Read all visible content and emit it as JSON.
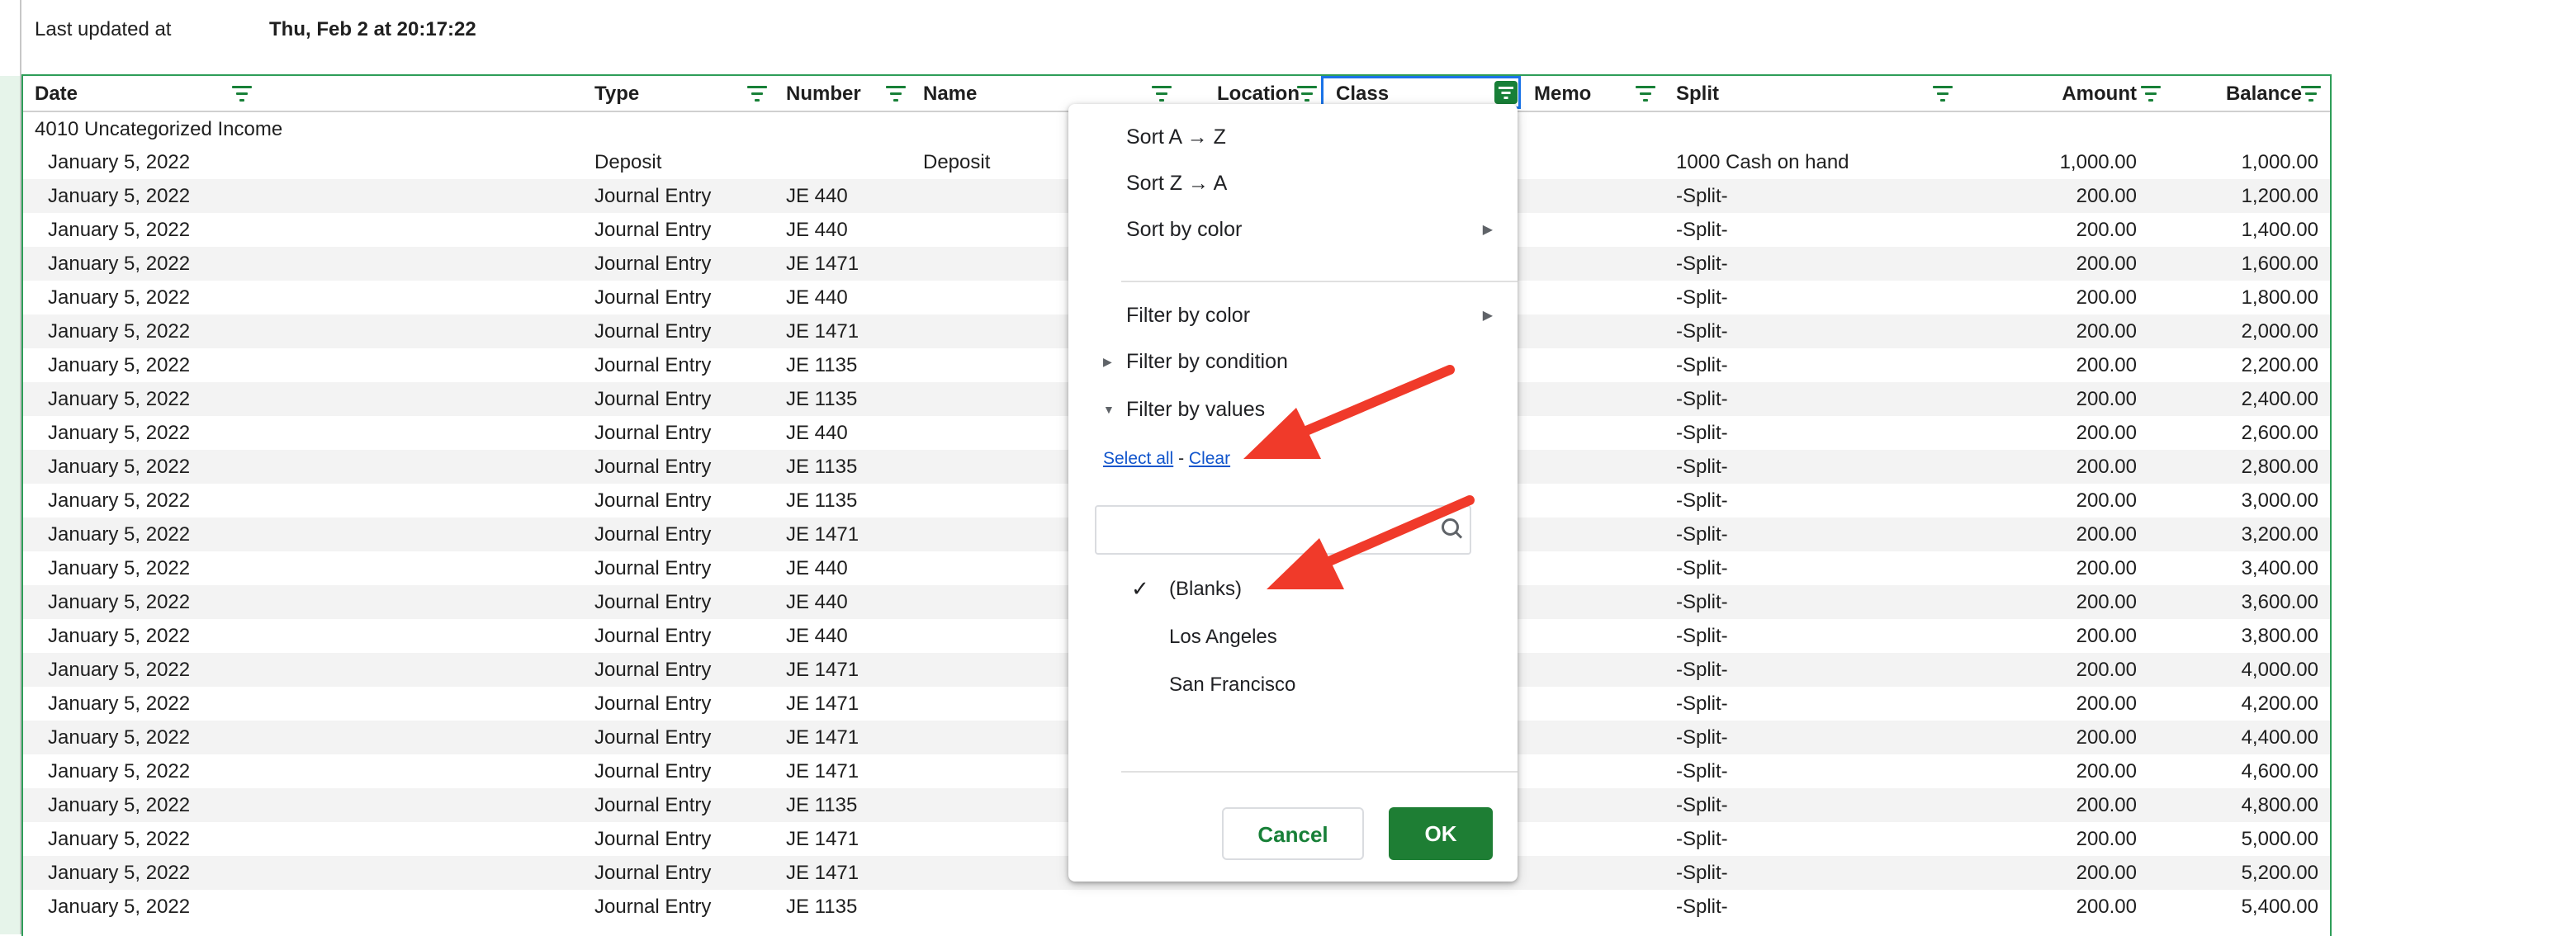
{
  "last_updated": {
    "label": "Last updated at",
    "value": "Thu, Feb 2 at 20:17:22"
  },
  "columns": [
    {
      "key": "date",
      "label": "Date"
    },
    {
      "key": "type",
      "label": "Type"
    },
    {
      "key": "number",
      "label": "Number"
    },
    {
      "key": "name",
      "label": "Name"
    },
    {
      "key": "location",
      "label": "Location"
    },
    {
      "key": "class",
      "label": "Class"
    },
    {
      "key": "memo",
      "label": "Memo"
    },
    {
      "key": "split",
      "label": "Split"
    },
    {
      "key": "amount",
      "label": "Amount"
    },
    {
      "key": "balance",
      "label": "Balance"
    }
  ],
  "group_label": "4010 Uncategorized Income",
  "rows": [
    {
      "date": "January 5, 2022",
      "type": "Deposit",
      "number": "",
      "name": "Deposit",
      "split": "1000 Cash on hand",
      "amount": "1,000.00",
      "balance": "1,000.00"
    },
    {
      "date": "January 5, 2022",
      "type": "Journal Entry",
      "number": "JE 440",
      "name": "",
      "split": "-Split-",
      "amount": "200.00",
      "balance": "1,200.00"
    },
    {
      "date": "January 5, 2022",
      "type": "Journal Entry",
      "number": "JE 440",
      "name": "",
      "split": "-Split-",
      "amount": "200.00",
      "balance": "1,400.00"
    },
    {
      "date": "January 5, 2022",
      "type": "Journal Entry",
      "number": "JE 1471",
      "name": "",
      "split": "-Split-",
      "amount": "200.00",
      "balance": "1,600.00"
    },
    {
      "date": "January 5, 2022",
      "type": "Journal Entry",
      "number": "JE 440",
      "name": "",
      "split": "-Split-",
      "amount": "200.00",
      "balance": "1,800.00"
    },
    {
      "date": "January 5, 2022",
      "type": "Journal Entry",
      "number": "JE 1471",
      "name": "",
      "split": "-Split-",
      "amount": "200.00",
      "balance": "2,000.00"
    },
    {
      "date": "January 5, 2022",
      "type": "Journal Entry",
      "number": "JE 1135",
      "name": "",
      "split": "-Split-",
      "amount": "200.00",
      "balance": "2,200.00"
    },
    {
      "date": "January 5, 2022",
      "type": "Journal Entry",
      "number": "JE 1135",
      "name": "",
      "split": "-Split-",
      "amount": "200.00",
      "balance": "2,400.00"
    },
    {
      "date": "January 5, 2022",
      "type": "Journal Entry",
      "number": "JE 440",
      "name": "",
      "split": "-Split-",
      "amount": "200.00",
      "balance": "2,600.00"
    },
    {
      "date": "January 5, 2022",
      "type": "Journal Entry",
      "number": "JE 1135",
      "name": "",
      "split": "-Split-",
      "amount": "200.00",
      "balance": "2,800.00"
    },
    {
      "date": "January 5, 2022",
      "type": "Journal Entry",
      "number": "JE 1135",
      "name": "",
      "split": "-Split-",
      "amount": "200.00",
      "balance": "3,000.00"
    },
    {
      "date": "January 5, 2022",
      "type": "Journal Entry",
      "number": "JE 1471",
      "name": "",
      "split": "-Split-",
      "amount": "200.00",
      "balance": "3,200.00"
    },
    {
      "date": "January 5, 2022",
      "type": "Journal Entry",
      "number": "JE 440",
      "name": "",
      "split": "-Split-",
      "amount": "200.00",
      "balance": "3,400.00"
    },
    {
      "date": "January 5, 2022",
      "type": "Journal Entry",
      "number": "JE 440",
      "name": "",
      "split": "-Split-",
      "amount": "200.00",
      "balance": "3,600.00"
    },
    {
      "date": "January 5, 2022",
      "type": "Journal Entry",
      "number": "JE 440",
      "name": "",
      "split": "-Split-",
      "amount": "200.00",
      "balance": "3,800.00"
    },
    {
      "date": "January 5, 2022",
      "type": "Journal Entry",
      "number": "JE 1471",
      "name": "",
      "split": "-Split-",
      "amount": "200.00",
      "balance": "4,000.00"
    },
    {
      "date": "January 5, 2022",
      "type": "Journal Entry",
      "number": "JE 1471",
      "name": "",
      "split": "-Split-",
      "amount": "200.00",
      "balance": "4,200.00"
    },
    {
      "date": "January 5, 2022",
      "type": "Journal Entry",
      "number": "JE 1471",
      "name": "",
      "split": "-Split-",
      "amount": "200.00",
      "balance": "4,400.00"
    },
    {
      "date": "January 5, 2022",
      "type": "Journal Entry",
      "number": "JE 1471",
      "name": "",
      "split": "-Split-",
      "amount": "200.00",
      "balance": "4,600.00"
    },
    {
      "date": "January 5, 2022",
      "type": "Journal Entry",
      "number": "JE 1135",
      "name": "",
      "split": "-Split-",
      "amount": "200.00",
      "balance": "4,800.00"
    },
    {
      "date": "January 5, 2022",
      "type": "Journal Entry",
      "number": "JE 1471",
      "name": "",
      "split": "-Split-",
      "amount": "200.00",
      "balance": "5,000.00"
    },
    {
      "date": "January 5, 2022",
      "type": "Journal Entry",
      "number": "JE 1471",
      "name": "",
      "split": "-Split-",
      "amount": "200.00",
      "balance": "5,200.00"
    },
    {
      "date": "January 5, 2022",
      "type": "Journal Entry",
      "number": "JE 1135",
      "name": "",
      "split": "-Split-",
      "amount": "200.00",
      "balance": "5,400.00"
    }
  ],
  "filter_menu": {
    "sort_az": "Sort A → Z",
    "sort_za": "Sort Z → A",
    "sort_by_color": "Sort by color",
    "filter_by_color": "Filter by color",
    "filter_by_condition": "Filter by condition",
    "filter_by_values": "Filter by values",
    "select_all": "Select all",
    "separator": "-",
    "clear": "Clear",
    "search_placeholder": "",
    "values": [
      {
        "label": "(Blanks)",
        "checked": true
      },
      {
        "label": "Los Angeles",
        "checked": false
      },
      {
        "label": "San Francisco",
        "checked": false
      }
    ],
    "cancel_label": "Cancel",
    "ok_label": "OK"
  },
  "colors": {
    "accent_green": "#188038",
    "ok_button": "#1e7e34",
    "link_blue": "#1155cc",
    "annotation_arrow": "#f03a2a",
    "selection_blue": "#1a73e8"
  }
}
